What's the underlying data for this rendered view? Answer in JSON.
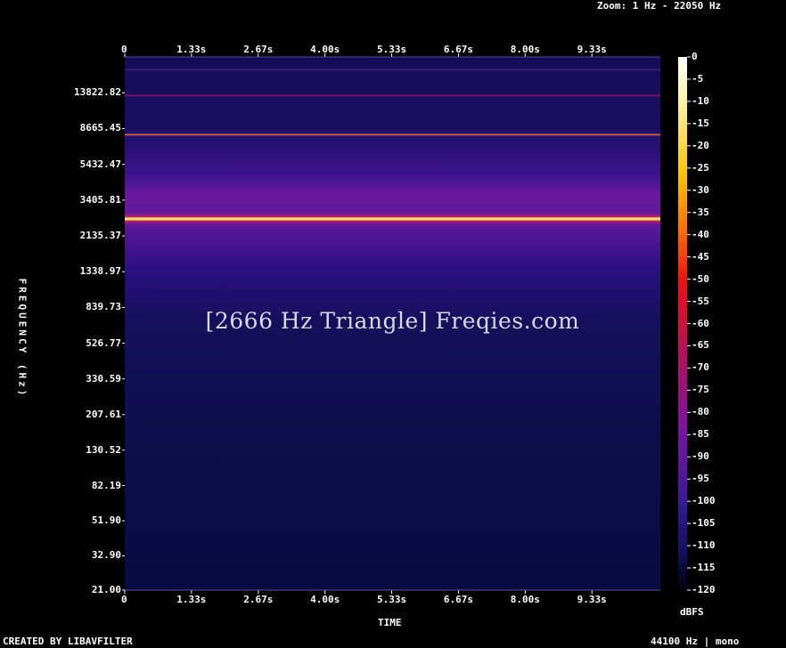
{
  "header": {
    "zoom": "Zoom: 1 Hz - 22050 Hz"
  },
  "footer": {
    "created_by": "CREATED BY LIBAVFILTER",
    "format": "44100 Hz | mono"
  },
  "colors": {
    "background": "#000000",
    "noise_floor": "#0b0b4a",
    "tone": "#ffe060",
    "harmonic": "#ff7a3a"
  },
  "chart_data": {
    "type": "heatmap",
    "title": "[2666 Hz Triangle] Freqies.com",
    "xlabel": "TIME",
    "ylabel": "FREQUENCY (Hz)",
    "colorbar_label": "dBFS",
    "x_ticks": [
      "0",
      "1.33s",
      "2.67s",
      "4.00s",
      "5.33s",
      "6.67s",
      "8.00s",
      "9.33s"
    ],
    "x_range": [
      0,
      10.7
    ],
    "x_ticks_s": [
      0,
      1.333,
      2.667,
      4.0,
      5.333,
      6.667,
      8.0,
      9.333
    ],
    "y_scale": "log",
    "y_range": [
      21,
      22050
    ],
    "y_ticks": [
      "13822.82",
      "8665.45",
      "5432.47",
      "3405.81",
      "2135.37",
      "1338.97",
      "839.73",
      "526.77",
      "330.59",
      "207.61",
      "130.52",
      "82.19",
      "51.90",
      "32.90",
      "21.00"
    ],
    "colorbar_ticks": [
      "0",
      "-5",
      "-10",
      "-15",
      "-20",
      "-25",
      "-30",
      "-35",
      "-40",
      "-45",
      "-50",
      "-55",
      "-60",
      "-65",
      "-70",
      "-75",
      "-80",
      "-85",
      "-90",
      "-95",
      "-100",
      "-105",
      "-110",
      "-115",
      "-120"
    ],
    "colorbar_range": [
      -120,
      0
    ],
    "bands": [
      {
        "freq_hz": 2666,
        "level_db": 0
      },
      {
        "freq_hz": 7998,
        "level_db": -30
      },
      {
        "freq_hz": 13330,
        "level_db": -55
      },
      {
        "freq_hz": 18662,
        "level_db": -85
      }
    ]
  }
}
